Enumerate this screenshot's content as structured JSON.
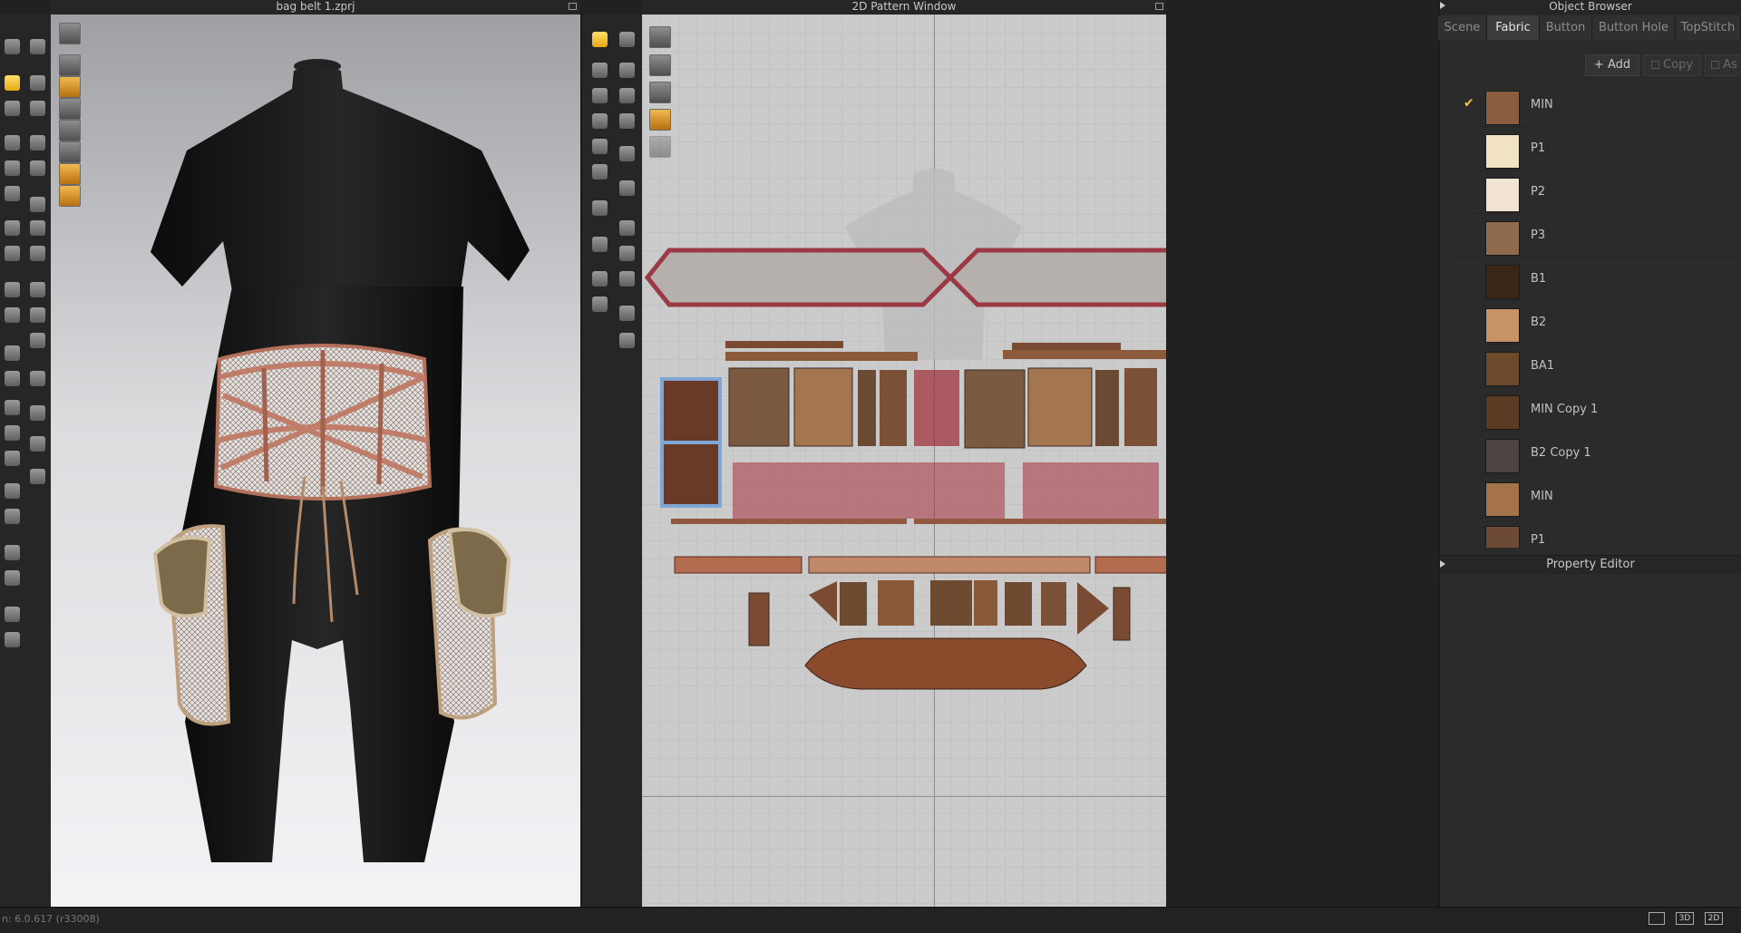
{
  "viewport3d": {
    "title": "bag belt 1.zprj"
  },
  "pattern2d": {
    "title": "2D Pattern Window"
  },
  "object_browser": {
    "title": "Object Browser",
    "tabs": [
      "Scene",
      "Fabric",
      "Button",
      "Button Hole",
      "TopStitch"
    ],
    "active_tab": "Fabric",
    "add_label": "Add",
    "copy_label": "Copy",
    "as_label": "As",
    "fabrics": [
      {
        "name": "MIN",
        "color": "#8a5d3f",
        "checked": true
      },
      {
        "name": "P1",
        "color": "#f2e2c4",
        "checked": false
      },
      {
        "name": "P2",
        "color": "#f0e4d0",
        "checked": false
      },
      {
        "name": "P3",
        "color": "#8f6a4d",
        "checked": false
      },
      {
        "name": "B1",
        "color": "#3a2616",
        "checked": false
      },
      {
        "name": "B2",
        "color": "#c79266",
        "checked": false
      },
      {
        "name": "BA1",
        "color": "#6d4a2c",
        "checked": false
      },
      {
        "name": "MIN Copy 1",
        "color": "#5b3b24",
        "checked": false
      },
      {
        "name": "B2 Copy 1",
        "color": "#4d4541",
        "checked": false
      },
      {
        "name": "MIN",
        "color": "#a5734a",
        "checked": false
      },
      {
        "name": "P1",
        "color": "#6c4a33",
        "checked": false
      }
    ]
  },
  "property_editor": {
    "title": "Property Editor"
  },
  "status": {
    "version": "n: 6.0.617 (r33008)",
    "view_3d": "3D",
    "view_2d": "2D"
  },
  "colors": {
    "accent": "#f1c232",
    "panel": "#2b2b2b",
    "pattern_bg": "#cbcbcb",
    "viewport_top": "#a6a7aa",
    "viewport_bottom": "#f2f2f2"
  }
}
